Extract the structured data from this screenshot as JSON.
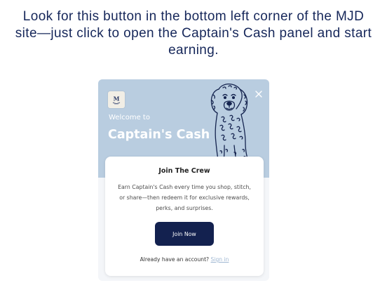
{
  "instructions": {
    "text": "Look for this button in the bottom left corner of the MJD site—just click to open the Captain's Cash panel and start earning."
  },
  "panel": {
    "logo_letter": "M",
    "welcome_text": "Welcome to",
    "title": "Captain's Cash",
    "close_icon": "close-icon",
    "hero_color": "#b9cde0",
    "card": {
      "title": "Join The Crew",
      "description": "Earn Captain's Cash every time you shop, stitch, or share—then redeem it for exclusive rewards, perks, and surprises.",
      "join_button_label": "Join Now",
      "account_prompt": "Already have an account?",
      "signin_link": "Sign in"
    },
    "button_color": "#13214f",
    "link_color": "#9fb7d2"
  }
}
